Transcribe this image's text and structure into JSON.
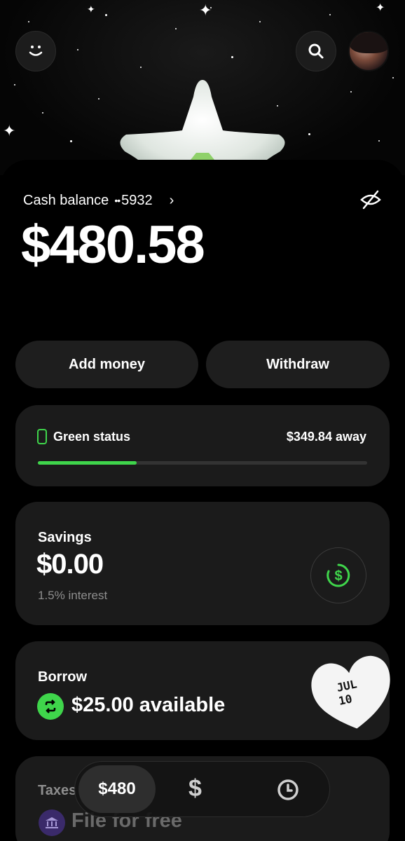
{
  "header": {
    "logo_icon": "smile-icon",
    "search_icon": "search-icon",
    "avatar_icon": "avatar"
  },
  "balance": {
    "label": "Cash balance",
    "account_dots": "••",
    "account_last4": "5932",
    "chevron": "›",
    "amount": "$480.58",
    "hide_icon": "eye-off-icon"
  },
  "actions": {
    "add_money": "Add money",
    "withdraw": "Withdraw"
  },
  "status": {
    "label": "Green status",
    "away": "$349.84 away",
    "progress_fraction": 0.3,
    "accent": "#3fd54b"
  },
  "savings": {
    "label": "Savings",
    "amount": "$0.00",
    "interest": "1.5% interest",
    "icon": "savings-dollar-icon"
  },
  "borrow": {
    "label": "Borrow",
    "amount": "$25.00 available",
    "icon": "borrow-refresh-icon"
  },
  "sticker": {
    "line1": "JUL",
    "line2": "10"
  },
  "taxes": {
    "label": "Taxes",
    "cta": "File for free",
    "icon": "bank-icon"
  },
  "nav": {
    "balance_tab": "$480",
    "dollar_tab": "$",
    "activity_icon": "clock-icon"
  },
  "colors": {
    "background": "#000000",
    "card": "#1b1b1b",
    "accent_green": "#3fd54b"
  }
}
